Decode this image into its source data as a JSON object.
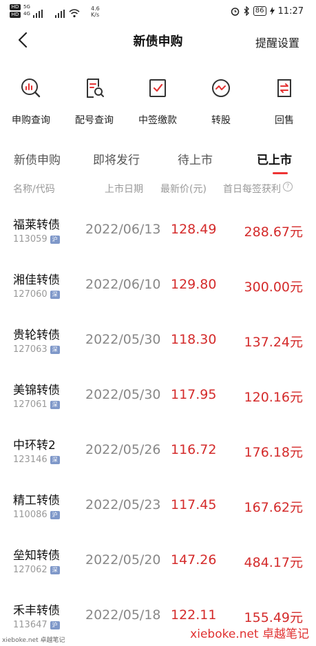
{
  "status_bar": {
    "hd_badge": "HD",
    "net_top": "5G",
    "net_bottom": "4G",
    "speed_value": "4.6",
    "speed_unit": "K/s",
    "battery": "86",
    "time": "11:27"
  },
  "nav": {
    "title": "新债申购",
    "right_action": "提醒设置"
  },
  "quick_actions": [
    {
      "label": "申购查询",
      "icon": "search-chart-icon"
    },
    {
      "label": "配号查询",
      "icon": "doc-search-icon"
    },
    {
      "label": "中签缴款",
      "icon": "checkbox-icon"
    },
    {
      "label": "转股",
      "icon": "swap-circle-icon"
    },
    {
      "label": "回售",
      "icon": "exchange-doc-icon"
    }
  ],
  "tabs": [
    "新债申购",
    "即将发行",
    "待上市",
    "已上市"
  ],
  "active_tab": "已上市",
  "columns": {
    "name": "名称/代码",
    "date": "上市日期",
    "price": "最新价(元)",
    "gain": "首日每签获利"
  },
  "rows": [
    {
      "name": "福莱转债",
      "code": "113059",
      "market": "沪",
      "date": "2022/06/13",
      "price": "128.49",
      "gain": "288.67元"
    },
    {
      "name": "湘佳转债",
      "code": "127060",
      "market": "深",
      "date": "2022/06/10",
      "price": "129.80",
      "gain": "300.00元"
    },
    {
      "name": "贵轮转债",
      "code": "127063",
      "market": "深",
      "date": "2022/05/30",
      "price": "118.30",
      "gain": "137.24元"
    },
    {
      "name": "美锦转债",
      "code": "127061",
      "market": "深",
      "date": "2022/05/30",
      "price": "117.95",
      "gain": "120.16元"
    },
    {
      "name": "中环转2",
      "code": "123146",
      "market": "深",
      "date": "2022/05/26",
      "price": "116.72",
      "gain": "176.18元"
    },
    {
      "name": "精工转债",
      "code": "110086",
      "market": "沪",
      "date": "2022/05/23",
      "price": "117.45",
      "gain": "167.62元"
    },
    {
      "name": "垒知转债",
      "code": "127062",
      "market": "深",
      "date": "2022/05/20",
      "price": "147.26",
      "gain": "484.17元"
    },
    {
      "name": "禾丰转债",
      "code": "113647",
      "market": "沪",
      "date": "2022/05/18",
      "price": "122.11",
      "gain": "155.49元"
    }
  ],
  "watermarks": {
    "bottom_left": "xieboke.net 卓越笔记",
    "bottom_right": "xieboke.net 卓越笔记"
  },
  "colors": {
    "accent": "#e33333",
    "price_red": "#d42b2b",
    "tag_blue": "#7f98c9"
  }
}
